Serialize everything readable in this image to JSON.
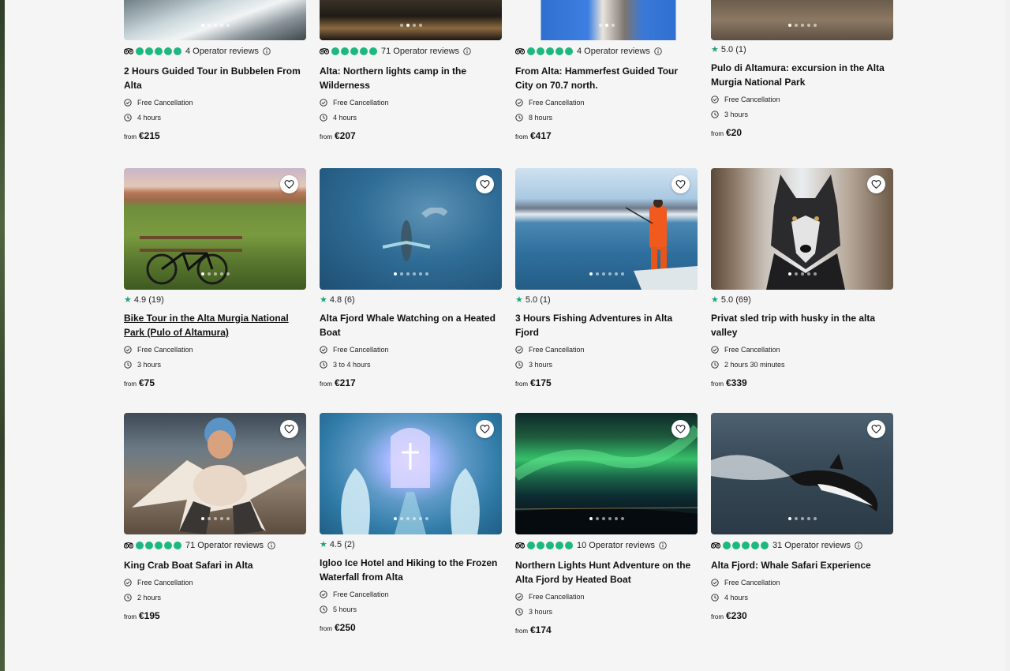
{
  "row1": [
    {
      "rating": "4 Operator reviews",
      "title": "2 Hours Guided Tour in Bubbelen From Alta",
      "cancel": "Free Cancellation",
      "duration": "4 hours",
      "from": "from",
      "price": "€215"
    },
    {
      "rating": "71 Operator reviews",
      "title": "Alta: Northern lights camp in the Wilderness",
      "cancel": "Free Cancellation",
      "duration": "4 hours",
      "from": "from",
      "price": "€207"
    },
    {
      "rating": "4 Operator reviews",
      "title": "From Alta: Hammerfest Guided Tour City on 70.7 north.",
      "cancel": "Free Cancellation",
      "duration": "8 hours",
      "from": "from",
      "price": "€417"
    },
    {
      "rating": "5.0 (1)",
      "title": "Pulo di Altamura: excursion in the Alta Murgia National Park",
      "cancel": "Free Cancellation",
      "duration": "3 hours",
      "from": "from",
      "price": "€20"
    }
  ],
  "row2": [
    {
      "rating": "4.9 (19)",
      "title": "Bike Tour in the Alta Murgia National Park (Pulo of Altamura)",
      "cancel": "Free Cancellation",
      "duration": "3 hours",
      "from": "from",
      "price": "€75"
    },
    {
      "rating": "4.8 (6)",
      "title": "Alta Fjord Whale Watching on a Heated Boat",
      "cancel": "Free Cancellation",
      "duration": "3 to 4 hours",
      "from": "from",
      "price": "€217"
    },
    {
      "rating": "5.0 (1)",
      "title": "3 Hours Fishing Adventures in Alta Fjord",
      "cancel": "Free Cancellation",
      "duration": "3 hours",
      "from": "from",
      "price": "€175"
    },
    {
      "rating": "5.0 (69)",
      "title": "Privat sled trip with husky in the alta valley",
      "cancel": "Free Cancellation",
      "duration": "2 hours 30 minutes",
      "from": "from",
      "price": "€339"
    }
  ],
  "row3": [
    {
      "rating": "71 Operator reviews",
      "title": "King Crab Boat Safari in Alta",
      "cancel": "Free Cancellation",
      "duration": "2 hours",
      "from": "from",
      "price": "€195"
    },
    {
      "rating": "4.5 (2)",
      "title": "Igloo Ice Hotel and Hiking to the Frozen Waterfall from Alta",
      "cancel": "Free Cancellation",
      "duration": "5 hours",
      "from": "from",
      "price": "€250"
    },
    {
      "rating": "10 Operator reviews",
      "title": "Northern Lights Hunt Adventure on the Alta Fjord by Heated Boat",
      "cancel": "Free Cancellation",
      "duration": "3 hours",
      "from": "from",
      "price": "€174"
    },
    {
      "rating": "31 Operator reviews",
      "title": "Alta Fjord: Whale Safari Experience",
      "cancel": "Free Cancellation",
      "duration": "4 hours",
      "from": "from",
      "price": "€230"
    }
  ],
  "icons": {
    "favorite": "heart-icon",
    "cancel": "check-circle-icon",
    "duration": "clock-icon",
    "rating_star": "star-icon",
    "operator": "tripadvisor-icon",
    "info": "info-icon"
  },
  "colors": {
    "accent": "#1fa37a",
    "bubble": "#1db87f",
    "background": "#f5f5f5"
  }
}
